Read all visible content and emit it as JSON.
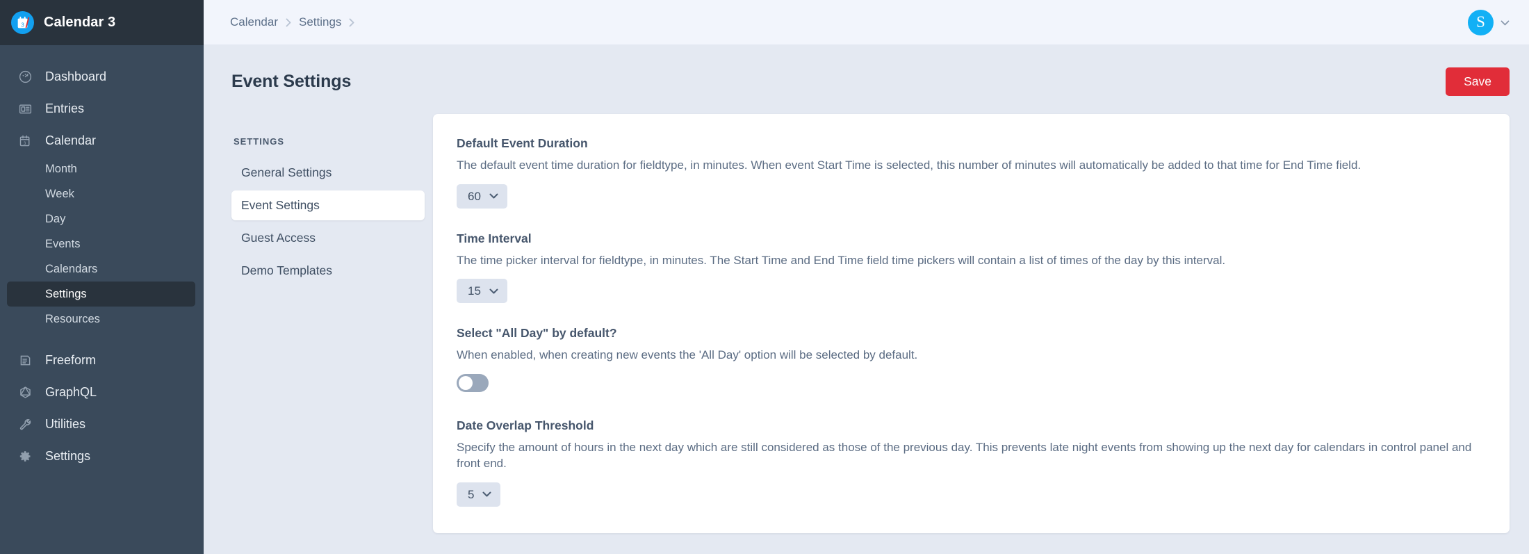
{
  "brand": {
    "title": "Calendar 3",
    "logo_icon": "calendar-3-logo-icon"
  },
  "sidebar": {
    "items": [
      {
        "label": "Dashboard",
        "icon": "gauge-icon"
      },
      {
        "label": "Entries",
        "icon": "entries-icon"
      },
      {
        "label": "Calendar",
        "icon": "calendar-icon"
      }
    ],
    "calendar_sub_items": [
      {
        "label": "Month"
      },
      {
        "label": "Week"
      },
      {
        "label": "Day"
      },
      {
        "label": "Events"
      },
      {
        "label": "Calendars"
      },
      {
        "label": "Settings",
        "selected": true
      },
      {
        "label": "Resources"
      }
    ],
    "bottom_items": [
      {
        "label": "Freeform",
        "icon": "freeform-icon"
      },
      {
        "label": "GraphQL",
        "icon": "graphql-icon"
      },
      {
        "label": "Utilities",
        "icon": "wrench-icon"
      },
      {
        "label": "Settings",
        "icon": "gear-icon"
      }
    ]
  },
  "topbar": {
    "breadcrumb": [
      {
        "label": "Calendar"
      },
      {
        "label": "Settings"
      }
    ],
    "account": {
      "avatar_initial": "S",
      "caret_icon": "chevron-down-icon"
    }
  },
  "page": {
    "title": "Event Settings",
    "save_label": "Save"
  },
  "settings_nav": {
    "heading": "SETTINGS",
    "items": [
      {
        "label": "General Settings",
        "selected": false
      },
      {
        "label": "Event Settings",
        "selected": true
      },
      {
        "label": "Guest Access",
        "selected": false
      },
      {
        "label": "Demo Templates",
        "selected": false
      }
    ]
  },
  "fields": [
    {
      "label": "Default Event Duration",
      "description": "The default event time duration for fieldtype, in minutes. When event Start Time is selected, this number of minutes will automatically be added to that time for End Time field.",
      "control": "select",
      "value": "60"
    },
    {
      "label": "Time Interval",
      "description": "The time picker interval for fieldtype, in minutes. The Start Time and End Time field time pickers will contain a list of times of the day by this interval.",
      "control": "select",
      "value": "15"
    },
    {
      "label": "Select \"All Day\" by default?",
      "description": "When enabled, when creating new events the 'All Day' option will be selected by default.",
      "control": "toggle",
      "value": "off"
    },
    {
      "label": "Date Overlap Threshold",
      "description": "Specify the amount of hours in the next day which are still considered as those of the previous day. This prevents late night events from showing up the next day for calendars in control panel and front end.",
      "control": "select",
      "value": "5"
    }
  ],
  "colors": {
    "sidebar_bg": "#3a4a5b",
    "sidebar_brand_bg": "#29333d",
    "accent_blue": "#12a0f0",
    "save_red": "#e12d39",
    "page_bg": "#e4e9f2"
  }
}
